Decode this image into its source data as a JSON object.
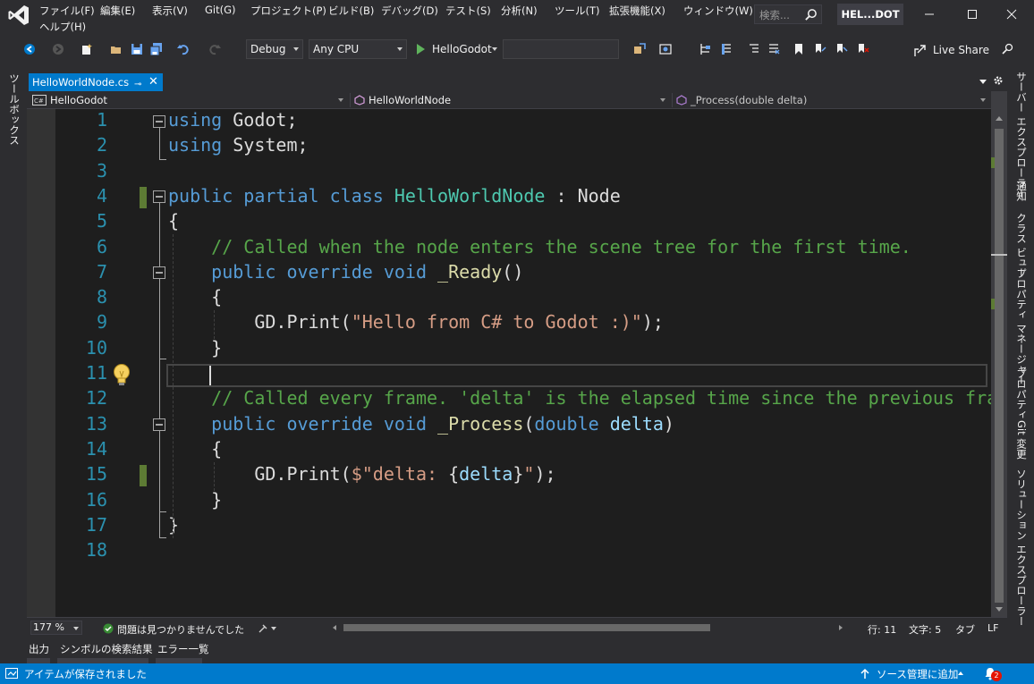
{
  "menu": {
    "items": [
      "ファイル(F)",
      "編集(E)",
      "表示(V)",
      "Git(G)",
      "プロジェクト(P)",
      "ビルド(B)",
      "デバッグ(D)",
      "テスト(S)",
      "分析(N)",
      "ツール(T)",
      "拡張機能(X)",
      "ウィンドウ(W)"
    ],
    "help": "ヘルプ(H)"
  },
  "search": {
    "placeholder": "検索..."
  },
  "solution_name": "HEL...DOT",
  "toolbar": {
    "config": "Debug",
    "platform": "Any CPU",
    "run_label": "HelloGodot",
    "live_share": "Live Share"
  },
  "left_strip": {
    "toolbox": "ツールボックス"
  },
  "right_strip": {
    "items": [
      "サーバー エクスプローラー",
      "通知",
      "クラス ビュー",
      "プロパティ マネージャー",
      "プロパティ",
      "Git 変更",
      "ソリューション エクスプローラー"
    ]
  },
  "tab": {
    "title": "HelloWorldNode.cs",
    "pin": "⊸",
    "close": "✕"
  },
  "navbar": {
    "project": "HelloGodot",
    "class": "HelloWorldNode",
    "member": "_Process(double delta)"
  },
  "editor": {
    "line_numbers": [
      "1",
      "2",
      "3",
      "4",
      "5",
      "6",
      "7",
      "8",
      "9",
      "10",
      "11",
      "12",
      "13",
      "14",
      "15",
      "16",
      "17",
      "18"
    ],
    "lines": [
      [
        [
          "k",
          "using"
        ],
        [
          "",
          "Godot;"
        ]
      ],
      [
        [
          "k",
          "using"
        ],
        [
          "",
          "System;"
        ]
      ],
      [],
      [
        [
          "k",
          "public partial class"
        ],
        [
          "t",
          "HelloWorldNode"
        ],
        [
          "",
          " : Node"
        ]
      ],
      [
        [
          "",
          "{"
        ]
      ],
      [
        [
          "c",
          "    // Called when the node enters the scene tree for the first time."
        ]
      ],
      [
        [
          "k",
          "    public override void"
        ],
        [
          "m",
          "_Ready"
        ],
        [
          "",
          "()"
        ]
      ],
      [
        [
          "",
          "    {"
        ]
      ],
      [
        [
          "",
          "        GD.Print("
        ],
        [
          "s",
          "\"Hello from C# to Godot :)\""
        ],
        [
          "",
          ");"
        ]
      ],
      [
        [
          "",
          "    }"
        ]
      ],
      [],
      [
        [
          "c",
          "    // Called every frame. 'delta' is the elapsed time since the previous frame."
        ]
      ],
      [
        [
          "k",
          "    public override void"
        ],
        [
          "m",
          "_Process"
        ],
        [
          "",
          "("
        ],
        [
          "k",
          "double"
        ],
        [
          "p",
          "delta"
        ],
        [
          "",
          ")"
        ]
      ],
      [
        [
          "",
          "    {"
        ]
      ],
      [
        [
          "",
          "        GD.Print("
        ],
        [
          "s",
          "$\"delta: "
        ],
        [
          "",
          "{"
        ],
        [
          "p",
          "delta"
        ],
        [
          "",
          "}"
        ],
        [
          "s",
          "\""
        ],
        [
          "",
          ");"
        ]
      ],
      [
        [
          "",
          "    }"
        ]
      ],
      [
        [
          "",
          "}"
        ]
      ],
      []
    ]
  },
  "editor_status": {
    "zoom": "177 %",
    "issues": "問題は見つかりませんでした",
    "line": "行: 11",
    "char": "文字: 5",
    "tab": "タブ",
    "eol": "LF"
  },
  "bottom_tabs": [
    "出力",
    "シンボルの検索結果",
    "エラー一覧"
  ],
  "statusbar": {
    "message": "アイテムが保存されました",
    "source_control": "ソース管理に追加",
    "notifications": "2"
  }
}
